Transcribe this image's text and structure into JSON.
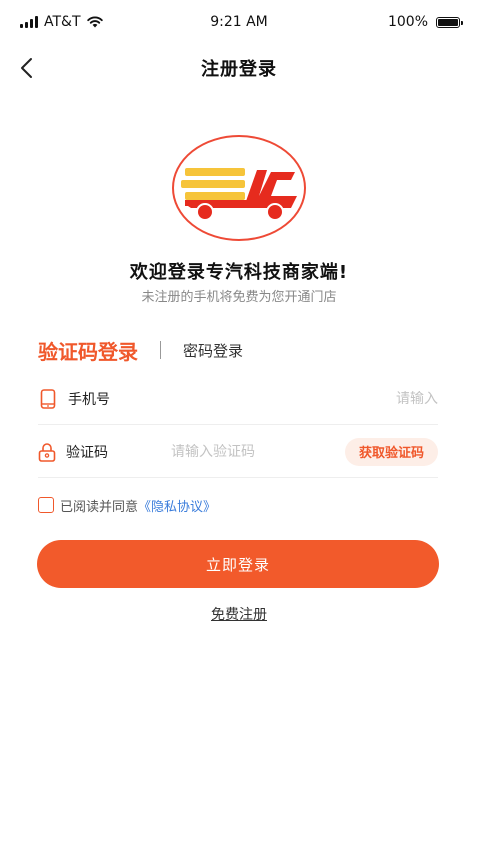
{
  "status_bar": {
    "carrier": "AT&T",
    "time": "9:21 AM",
    "battery": "100%"
  },
  "nav": {
    "title": "注册登录"
  },
  "welcome": {
    "title": "欢迎登录专汽科技商家端!",
    "subtitle": "未注册的手机将免费为您开通门店"
  },
  "tabs": {
    "active": "验证码登录",
    "inactive": "密码登录"
  },
  "form": {
    "phone_label": "手机号",
    "phone_placeholder": "请输入",
    "code_label": "验证码",
    "code_placeholder": "请输入验证码",
    "get_code": "获取验证码"
  },
  "agreement": {
    "text": "已阅读并同意",
    "link": "《隐私协议》"
  },
  "login_button": "立即登录",
  "register": "免费注册",
  "colors": {
    "accent": "#f25a2b",
    "link": "#3b7ddb",
    "code_button_bg": "#fdeee7"
  },
  "icons": {
    "back": "chevron-left-icon",
    "phone": "phone-icon",
    "code": "lock-icon",
    "wifi": "wifi-icon",
    "signal": "signal-icon",
    "battery": "battery-icon",
    "logo": "truck-logo"
  }
}
